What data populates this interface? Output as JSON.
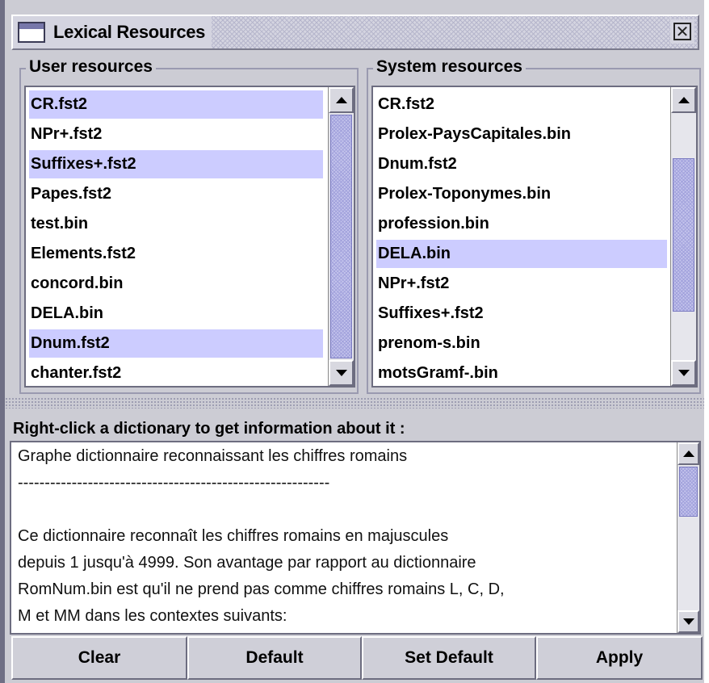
{
  "window": {
    "title": "Lexical Resources",
    "close_glyph": "✕"
  },
  "user_resources": {
    "label": "User resources",
    "items": [
      "CR.fst2",
      "NPr+.fst2",
      "Suffixes+.fst2",
      "Papes.fst2",
      "test.bin",
      "Elements.fst2",
      "concord.bin",
      "DELA.bin",
      "Dnum.fst2",
      "chanter.fst2"
    ],
    "selected": [
      "CR.fst2",
      "Suffixes+.fst2",
      "Dnum.fst2"
    ]
  },
  "system_resources": {
    "label": "System resources",
    "items": [
      "CR.fst2",
      "Prolex-PaysCapitales.bin",
      "Dnum.fst2",
      "Prolex-Toponymes.bin",
      "profession.bin",
      "DELA.bin",
      "NPr+.fst2",
      "Suffixes+.fst2",
      "prenom-s.bin",
      "motsGramf-.bin"
    ],
    "selected": [
      "DELA.bin"
    ]
  },
  "info": {
    "label": "Right-click a dictionary to get information about it :",
    "lines": [
      "Graphe dictionnaire reconnaissant les chiffres romains",
      "----------------------------------------------------------",
      "",
      "Ce dictionnaire reconnaît les chiffres romains en majuscules",
      "depuis 1 jusqu'à 4999. Son avantage par rapport au dictionnaire",
      "RomNum.bin est qu'il ne prend pas comme chiffres romains L, C, D,",
      "M et MM dans les contextes suivants:"
    ]
  },
  "buttons": {
    "clear": "Clear",
    "default": "Default",
    "set_default": "Set Default",
    "apply": "Apply"
  },
  "colors": {
    "selection": "#ccccff",
    "panel": "#ccccd4"
  }
}
